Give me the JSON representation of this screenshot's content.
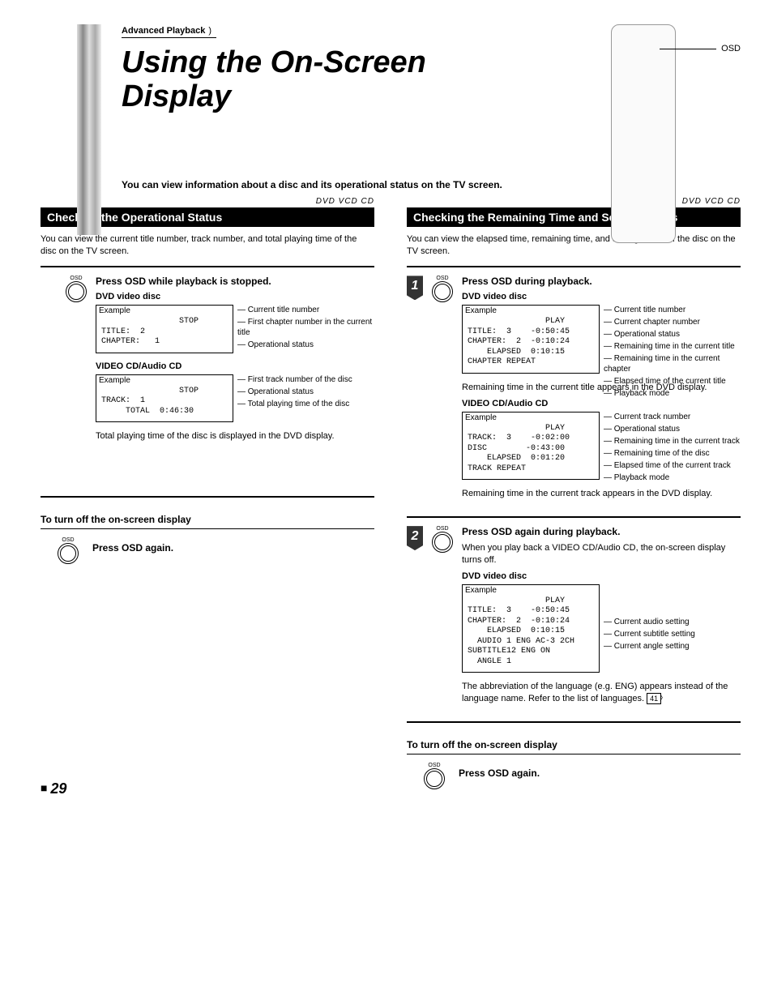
{
  "header": {
    "tab": "Advanced Playback",
    "title": "Using the On-Screen Display",
    "intro": "You can view information about a disc and its operational status on the TV screen.",
    "remote_label": "OSD"
  },
  "left": {
    "badges": "DVD   VCD   CD",
    "bar": "Checking the Operational Status",
    "desc": "You can view the current title number, track number, and total playing time of the disc on the TV screen.",
    "step1_title": "Press OSD while playback is stopped.",
    "dvd_head": "DVD video disc",
    "example": "Example",
    "dvd_screen": "                STOP\nTITLE:  2\nCHAPTER:   1",
    "dvd_callouts": {
      "a": "Current title number",
      "b": "First chapter number in the current title",
      "c": "Operational status"
    },
    "vcd_head": "VIDEO CD/Audio CD",
    "vcd_screen": "                STOP\nTRACK:  1\n     TOTAL  0:46:30",
    "vcd_callouts": {
      "a": "First track number of the disc",
      "b": "Operational status",
      "c": "Total playing time of the disc"
    },
    "vcd_note": "Total playing time of the disc is displayed in the DVD display.",
    "turnoff_head": "To turn off the on-screen display",
    "turnoff_text": "Press OSD again."
  },
  "right": {
    "badges": "DVD   VCD   CD",
    "bar": "Checking the Remaining Time and Setting Status",
    "desc": "You can view the elapsed time, remaining time, and setting status of the disc on the TV screen.",
    "step1_title": "Press OSD during playback.",
    "dvd_head": "DVD video disc",
    "example": "Example",
    "dvd_screen": "                PLAY\nTITLE:  3    -0:50:45\nCHAPTER:  2  -0:10:24\n    ELAPSED  0:10:15\nCHAPTER REPEAT",
    "dvd_callouts": {
      "a": "Current title number",
      "b": "Current chapter number",
      "c": "Operational status",
      "d": "Remaining time in the current title",
      "e": "Remaining time in the current chapter",
      "f": "Elapsed time of the current title",
      "g": "Playback mode"
    },
    "dvd_note": "Remaining time in the current title appears in the DVD display.",
    "vcd_head": "VIDEO CD/Audio CD",
    "vcd_screen": "                PLAY\nTRACK:  3    -0:02:00\nDISC        -0:43:00\n    ELAPSED  0:01:20\nTRACK REPEAT",
    "vcd_callouts": {
      "a": "Current track number",
      "b": "Operational status",
      "c": "Remaining time in the current track",
      "d": "Remaining time of the disc",
      "e": "Elapsed time of the current track",
      "f": "Playback mode"
    },
    "vcd_note": "Remaining time in the current track appears in the DVD display.",
    "step2_title": "Press OSD again during playback.",
    "step2_desc": "When you play back a VIDEO CD/Audio CD, the on-screen display turns off.",
    "dvd2_head": "DVD video disc",
    "dvd2_screen": "                PLAY\nTITLE:  3    -0:50:45\nCHAPTER:  2  -0:10:24\n    ELAPSED  0:10:15\n  AUDIO 1 ENG AC-3 2CH\nSUBTITLE12 ENG ON\n  ANGLE 1",
    "dvd2_callouts": {
      "a": "Current audio setting",
      "b": "Current subtitle setting",
      "c": "Current angle setting"
    },
    "dvd2_note_a": "The abbreviation of the language (e.g. ENG) appears instead of the language name. Refer to the list of languages.",
    "dvd2_ref": "41",
    "turnoff_head": "To turn off the on-screen display",
    "turnoff_text": "Press OSD again."
  },
  "page": "29",
  "osd_label": "OSD"
}
